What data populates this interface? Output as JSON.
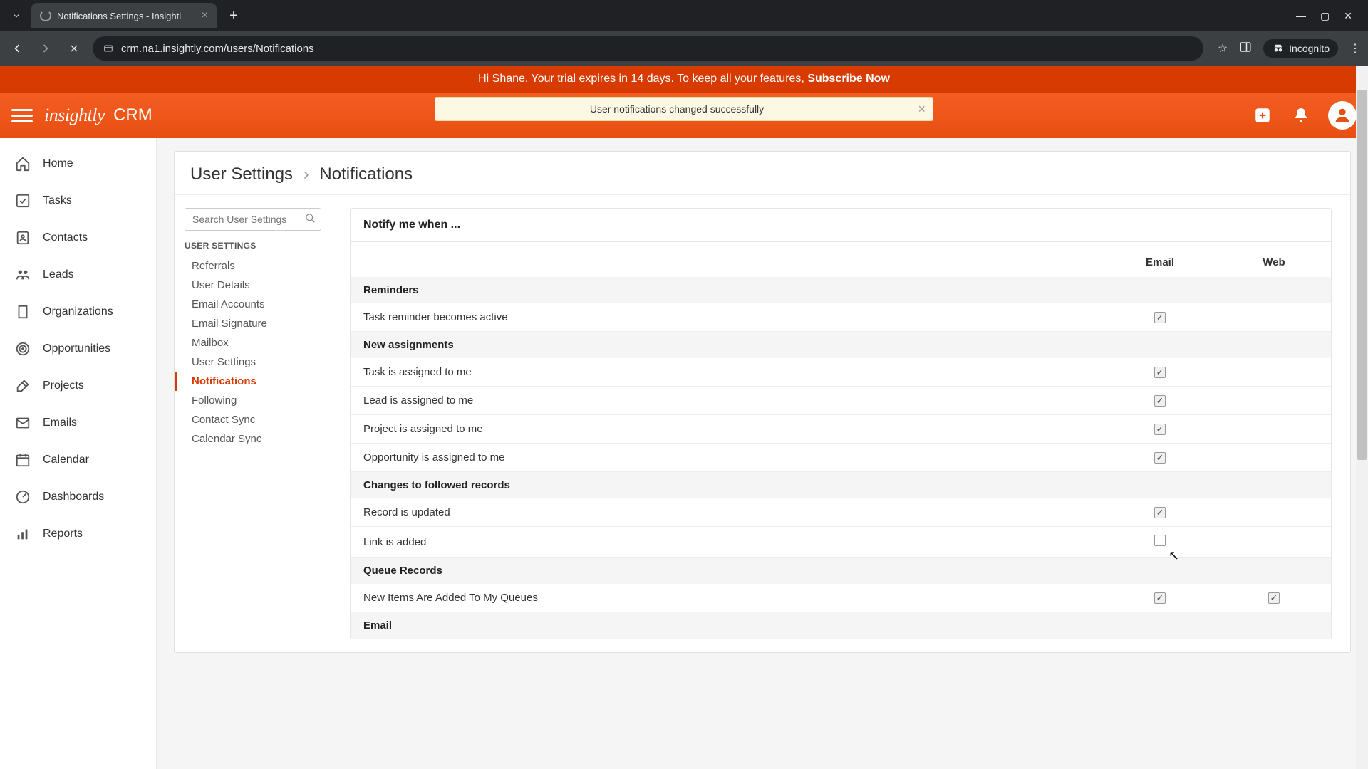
{
  "browser": {
    "tab_title": "Notifications Settings - Insightl",
    "url": "crm.na1.insightly.com/users/Notifications",
    "incognito_label": "Incognito"
  },
  "trial_banner": {
    "text_pre": "Hi Shane. Your trial expires in 14 days. To keep all your features, ",
    "link": "Subscribe Now"
  },
  "header": {
    "logo": "insightly",
    "product": "CRM",
    "toast": "User notifications changed successfully"
  },
  "left_nav": [
    {
      "icon": "home",
      "label": "Home"
    },
    {
      "icon": "tasks",
      "label": "Tasks"
    },
    {
      "icon": "contacts",
      "label": "Contacts"
    },
    {
      "icon": "leads",
      "label": "Leads"
    },
    {
      "icon": "org",
      "label": "Organizations"
    },
    {
      "icon": "target",
      "label": "Opportunities"
    },
    {
      "icon": "hammer",
      "label": "Projects"
    },
    {
      "icon": "mail",
      "label": "Emails"
    },
    {
      "icon": "calendar",
      "label": "Calendar"
    },
    {
      "icon": "dash",
      "label": "Dashboards"
    },
    {
      "icon": "reports",
      "label": "Reports"
    }
  ],
  "breadcrumb": {
    "root": "User Settings",
    "current": "Notifications"
  },
  "search_placeholder": "Search User Settings",
  "settings_heading": "USER SETTINGS",
  "settings_links": [
    "Referrals",
    "User Details",
    "Email Accounts",
    "Email Signature",
    "Mailbox",
    "User Settings",
    "Notifications",
    "Following",
    "Contact Sync",
    "Calendar Sync"
  ],
  "settings_active": "Notifications",
  "panel_title": "Notify me when ...",
  "columns": {
    "email": "Email",
    "web": "Web"
  },
  "sections": [
    {
      "title": "Reminders",
      "rows": [
        {
          "label": "Task reminder becomes active",
          "email": true,
          "web": null
        }
      ]
    },
    {
      "title": "New assignments",
      "rows": [
        {
          "label": "Task is assigned to me",
          "email": true,
          "web": null
        },
        {
          "label": "Lead is assigned to me",
          "email": true,
          "web": null
        },
        {
          "label": "Project is assigned to me",
          "email": true,
          "web": null
        },
        {
          "label": "Opportunity is assigned to me",
          "email": true,
          "web": null
        }
      ]
    },
    {
      "title": "Changes to followed records",
      "rows": [
        {
          "label": "Record is updated",
          "email": true,
          "web": null
        },
        {
          "label": "Link is added",
          "email": false,
          "web": null
        }
      ]
    },
    {
      "title": "Queue Records",
      "rows": [
        {
          "label": "New Items Are Added To My Queues",
          "email": true,
          "web": true
        }
      ]
    },
    {
      "title": "Email",
      "rows": []
    }
  ]
}
